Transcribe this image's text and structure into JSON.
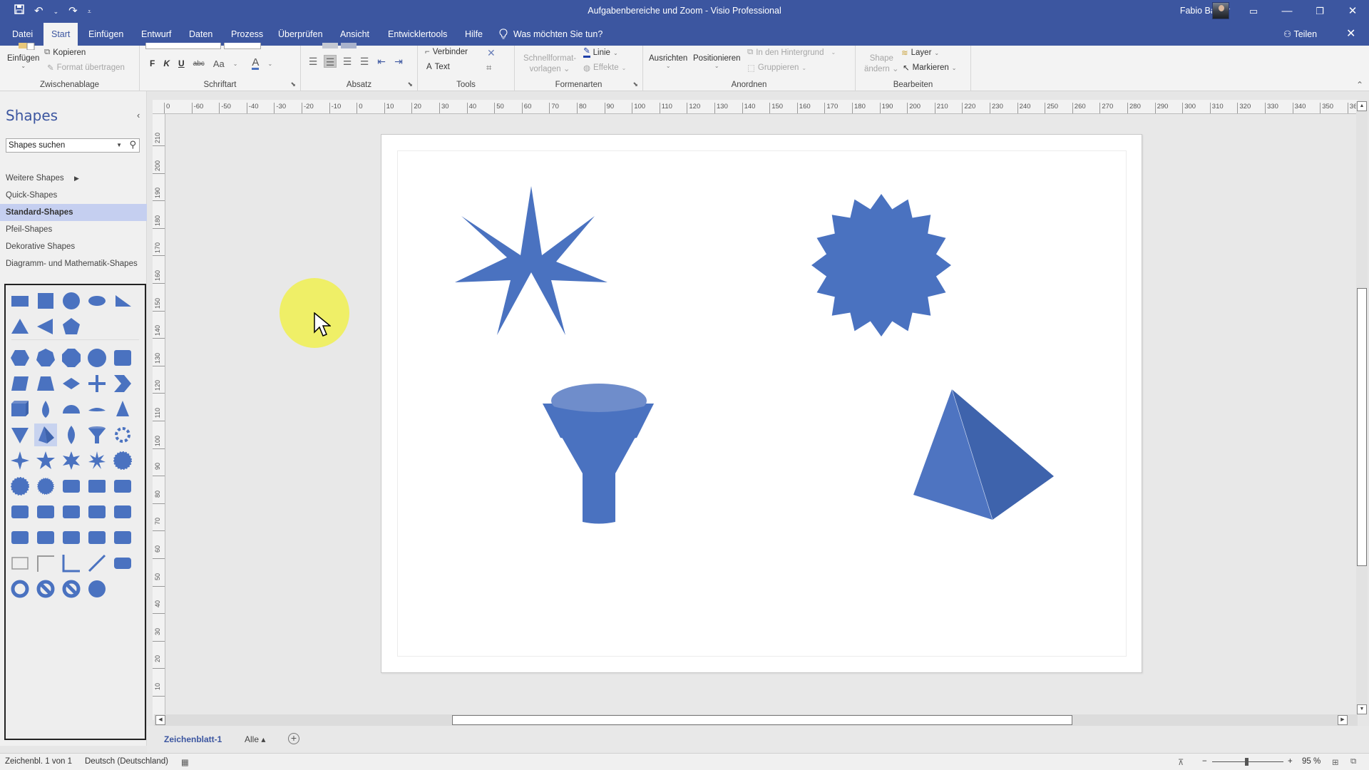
{
  "window": {
    "title": "Aufgabenbereiche und Zoom  -  Visio Professional",
    "user_name": "Fabio Basler",
    "controls": {
      "ribbon_display": "▭",
      "minimize": "—",
      "restore": "❐",
      "close": "✕"
    }
  },
  "quick_access": {
    "save": "🖫",
    "undo": "↶",
    "undo_dropdown": "⌄",
    "redo": "↷",
    "customize": "⩡"
  },
  "tabs": [
    {
      "label": "Datei"
    },
    {
      "label": "Start",
      "active": true
    },
    {
      "label": "Einfügen"
    },
    {
      "label": "Entwurf"
    },
    {
      "label": "Daten"
    },
    {
      "label": "Prozess"
    },
    {
      "label": "Überprüfen"
    },
    {
      "label": "Ansicht"
    },
    {
      "label": "Entwicklertools"
    },
    {
      "label": "Hilfe"
    }
  ],
  "tell_me": {
    "icon": "lightbulb-icon",
    "label": "Was möchten Sie tun?"
  },
  "share": {
    "label": "Teilen"
  },
  "ribbon": {
    "clipboard": {
      "label": "Zwischenablage",
      "paste": "Einfügen",
      "copy": "Kopieren",
      "format_painter": "Format übertragen"
    },
    "font": {
      "label": "Schriftart",
      "bold": "F",
      "italic": "K",
      "underline": "U",
      "strikethrough": "abc",
      "case": "Aa",
      "font_color": "A"
    },
    "paragraph": {
      "label": "Absatz",
      "selected_alignment": "center"
    },
    "tools": {
      "label": "Tools",
      "connector": "Verbinder",
      "text": "Text"
    },
    "shape_styles": {
      "label": "Formenarten",
      "quick_styles_line1": "Schnellformat-",
      "quick_styles_line2": "vorlagen",
      "line": "Linie",
      "effects": "Effekte"
    },
    "arrange": {
      "label": "Anordnen",
      "align": "Ausrichten",
      "position": "Positionieren",
      "send_back": "In den Hintergrund",
      "group": "Gruppieren"
    },
    "editing": {
      "label": "Bearbeiten",
      "change_shape_line1": "Shape",
      "change_shape_line2": "ändern",
      "layer": "Layer",
      "select": "Markieren"
    }
  },
  "shapes_pane": {
    "title": "Shapes",
    "search_placeholder": "Shapes suchen",
    "stencils": [
      {
        "label": "Weitere Shapes",
        "has_submenu": true
      },
      {
        "label": "Quick-Shapes"
      },
      {
        "label": "Standard-Shapes",
        "selected": true
      },
      {
        "label": "Pfeil-Shapes"
      },
      {
        "label": "Dekorative Shapes"
      },
      {
        "label": "Diagramm- und Mathematik-Shapes"
      }
    ],
    "shape_color": "#4a72c0",
    "selected_shape": "pyramid"
  },
  "rulers": {
    "horizontal": [
      "0",
      "-60",
      "-50",
      "-40",
      "-30",
      "-20",
      "-10",
      "0",
      "10",
      "20",
      "30",
      "40",
      "50",
      "60",
      "70",
      "80",
      "90",
      "100",
      "110",
      "120",
      "130",
      "140",
      "150",
      "160",
      "170",
      "180",
      "190",
      "200",
      "210",
      "220",
      "230",
      "240",
      "250",
      "260",
      "270",
      "280",
      "290",
      "300",
      "310",
      "320",
      "330",
      "340",
      "350",
      "36"
    ],
    "vertical": [
      "210",
      "200",
      "190",
      "180",
      "170",
      "160",
      "150",
      "140",
      "130",
      "120",
      "110",
      "100",
      "90",
      "80",
      "70",
      "60",
      "50",
      "40",
      "30",
      "20",
      "10"
    ]
  },
  "canvas": {
    "shapes": [
      {
        "name": "star-7-point"
      },
      {
        "name": "starburst-24-point"
      },
      {
        "name": "funnel"
      },
      {
        "name": "pyramid"
      }
    ],
    "fill_color": "#4a72c0",
    "highlight_color": "#f0f050"
  },
  "page_tabs": {
    "active": "Zeichenblatt-1",
    "all": "Alle ▴",
    "add": "+"
  },
  "status": {
    "page_info": "Zeichenbl. 1 von 1",
    "language": "Deutsch (Deutschland)",
    "zoom_percent": "95 %",
    "zoom_value": 95,
    "zoom_minus": "−",
    "zoom_plus": "+"
  }
}
